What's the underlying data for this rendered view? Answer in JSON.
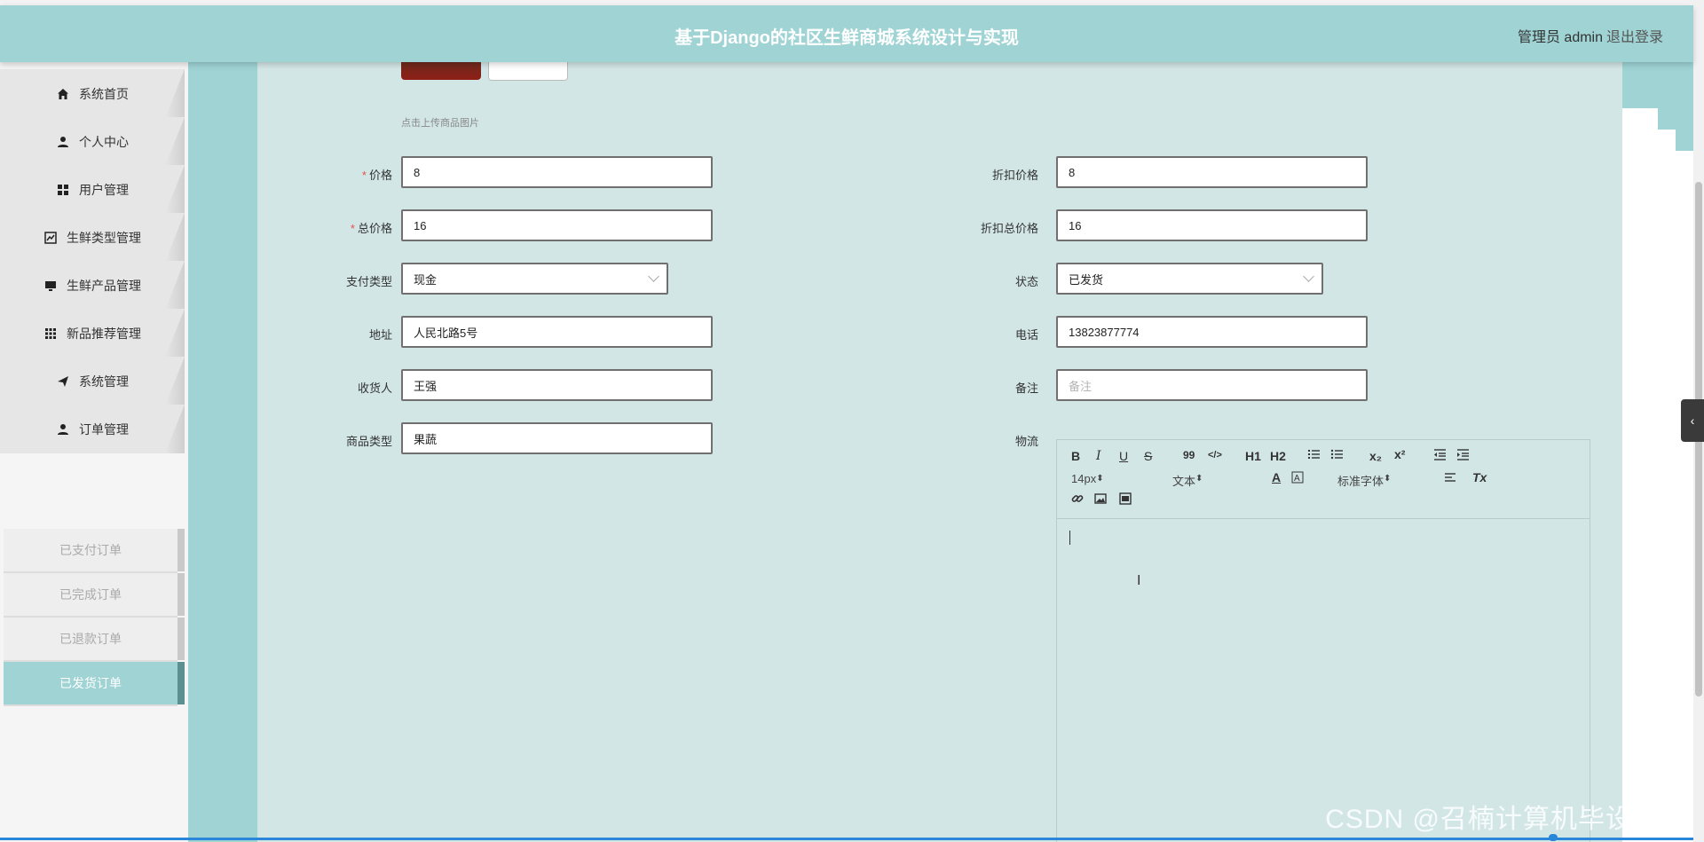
{
  "header": {
    "title": "基于Django的社区生鲜商城系统设计与实现",
    "user": "管理员 admin",
    "logout": "退出登录"
  },
  "sidebar": {
    "items": [
      {
        "label": "系统首页",
        "icon": "home-icon"
      },
      {
        "label": "个人中心",
        "icon": "person-icon"
      },
      {
        "label": "用户管理",
        "icon": "grid-icon"
      },
      {
        "label": "生鲜类型管理",
        "icon": "chart-icon"
      },
      {
        "label": "生鲜产品管理",
        "icon": "monitor-icon"
      },
      {
        "label": "新品推荐管理",
        "icon": "apps-icon"
      },
      {
        "label": "系统管理",
        "icon": "send-icon"
      },
      {
        "label": "订单管理",
        "icon": "person-icon"
      }
    ],
    "subitems": [
      {
        "label": "已支付订单"
      },
      {
        "label": "已完成订单"
      },
      {
        "label": "已退款订单"
      },
      {
        "label": "已发货订单",
        "active": true
      }
    ]
  },
  "form": {
    "image_hint": "点击上传商品图片",
    "price": {
      "label": "价格",
      "value": "8",
      "required": "*"
    },
    "discount_price": {
      "label": "折扣价格",
      "value": "8"
    },
    "total_price": {
      "label": "总价格",
      "value": "16",
      "required": "*"
    },
    "discount_total": {
      "label": "折扣总价格",
      "value": "16"
    },
    "pay_type": {
      "label": "支付类型",
      "value": "现金"
    },
    "status": {
      "label": "状态",
      "value": "已发货"
    },
    "address": {
      "label": "地址",
      "value": "人民北路5号"
    },
    "phone": {
      "label": "电话",
      "value": "13823877774"
    },
    "receiver": {
      "label": "收货人",
      "value": "王强"
    },
    "remark": {
      "label": "备注",
      "placeholder": "备注"
    },
    "category": {
      "label": "商品类型",
      "value": "果蔬"
    },
    "logistics": {
      "label": "物流"
    }
  },
  "editor": {
    "bold": "B",
    "italic": "I",
    "underline": "U",
    "strike": "S",
    "quote": "99",
    "code": "</>",
    "h1": "H1",
    "h2": "H2",
    "sub": "x₂",
    "sup": "x²",
    "size": "14px",
    "header_select": "文本",
    "font_select": "标准字体",
    "clean": "Tx"
  },
  "sidetab": "‹",
  "watermark": "CSDN @召楠计算机毕设程序"
}
